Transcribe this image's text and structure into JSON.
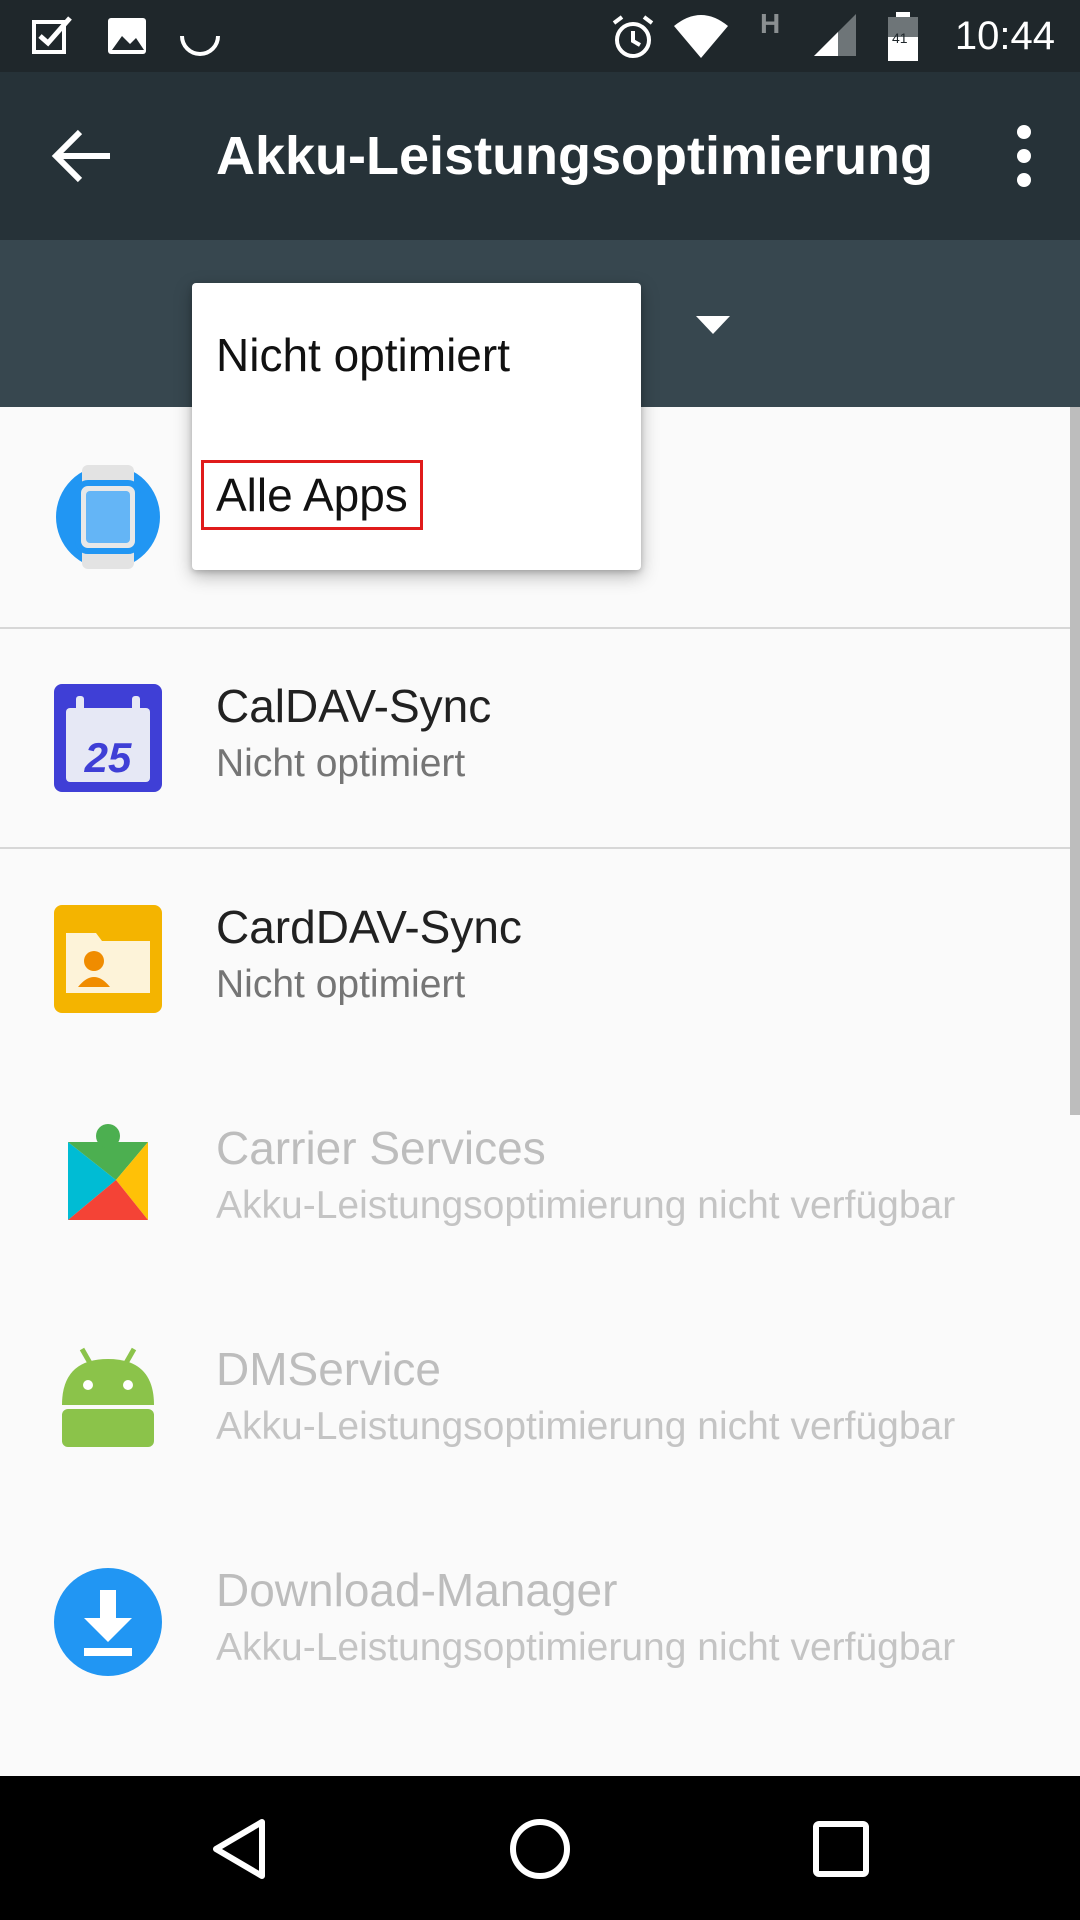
{
  "status_bar": {
    "time": "10:44",
    "battery_level": "41",
    "network_type": "H",
    "left_icons": [
      "task-check-icon",
      "image-icon",
      "sync-spinner-icon"
    ],
    "right_icons": [
      "alarm-icon",
      "wifi-icon",
      "network-type-icon",
      "cell-signal-icon",
      "battery-icon"
    ]
  },
  "app_bar": {
    "title": "Akku-Leistungsoptimierung",
    "back_icon": "arrow-left-icon",
    "menu_icon": "more-vert-icon"
  },
  "spinner": {
    "arrow_icon": "dropdown-arrow-icon"
  },
  "dropdown": {
    "options": [
      {
        "label": "Nicht optimiert"
      },
      {
        "label": "Alle Apps"
      }
    ]
  },
  "apps": [
    {
      "name": "",
      "status": "",
      "icon": "android-wear-icon",
      "enabled": true
    },
    {
      "name": "CalDAV-Sync",
      "status": "Nicht optimiert",
      "icon": "calendar-icon",
      "enabled": true
    },
    {
      "name": "CardDAV-Sync",
      "status": "Nicht optimiert",
      "icon": "contacts-folder-icon",
      "enabled": true
    },
    {
      "name": "Carrier Services",
      "status": "Akku-Leistungsoptimierung nicht verfügbar",
      "icon": "play-services-icon",
      "enabled": false
    },
    {
      "name": "DMService",
      "status": "Akku-Leistungsoptimierung nicht verfügbar",
      "icon": "android-robot-icon",
      "enabled": false
    },
    {
      "name": "Download-Manager",
      "status": "Akku-Leistungsoptimierung nicht verfügbar",
      "icon": "download-icon",
      "enabled": false
    }
  ],
  "nav_bar": {
    "icons": [
      "back-triangle-icon",
      "home-circle-icon",
      "recents-square-icon"
    ]
  },
  "colors": {
    "status_bar": "#1f272b",
    "app_bar": "#263238",
    "spinner_bar": "#37474f",
    "background": "#fafafa",
    "highlight": "#e01b1b"
  }
}
